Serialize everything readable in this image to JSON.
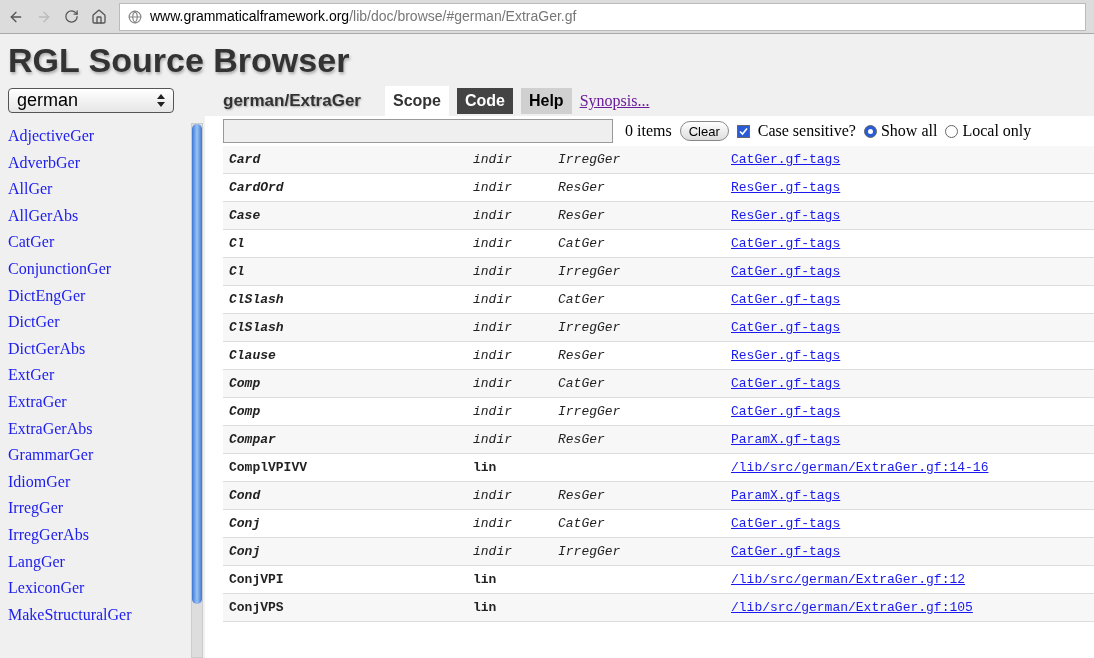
{
  "browser": {
    "url_host": "www.grammaticalframework.org",
    "url_path": "/lib/doc/browse/#german/ExtraGer.gf"
  },
  "title": "RGL Source Browser",
  "sidebar": {
    "language": "german",
    "scroll": {
      "level": 0.9
    },
    "items": [
      "AdjectiveGer",
      "AdverbGer",
      "AllGer",
      "AllGerAbs",
      "CatGer",
      "ConjunctionGer",
      "DictEngGer",
      "DictGer",
      "DictGerAbs",
      "ExtGer",
      "ExtraGer",
      "ExtraGerAbs",
      "GrammarGer",
      "IdiomGer",
      "IrregGer",
      "IrregGerAbs",
      "LangGer",
      "LexiconGer",
      "MakeStructuralGer"
    ]
  },
  "module": "german/ExtraGer",
  "tabs": [
    {
      "label": "Scope",
      "selected": true,
      "highlighted": false
    },
    {
      "label": "Code",
      "selected": false,
      "highlighted": true
    },
    {
      "label": "Help",
      "selected": false,
      "highlighted": false
    }
  ],
  "synopsis_link": "Synopsis...",
  "filter": {
    "count": "0 items",
    "clear": "Clear",
    "case_label": "Case sensitive?",
    "case_checked": true,
    "options": [
      {
        "label": "Show all",
        "selected": true
      },
      {
        "label": "Local only",
        "selected": false
      }
    ]
  },
  "rows": [
    {
      "kind": "indir",
      "name": "Card",
      "type": "indir",
      "module": "IrregGer",
      "link": "CatGer.gf-tags"
    },
    {
      "kind": "indir",
      "name": "CardOrd",
      "type": "indir",
      "module": "ResGer",
      "link": "ResGer.gf-tags"
    },
    {
      "kind": "indir",
      "name": "Case",
      "type": "indir",
      "module": "ResGer",
      "link": "ResGer.gf-tags"
    },
    {
      "kind": "indir",
      "name": "Cl",
      "type": "indir",
      "module": "CatGer",
      "link": "CatGer.gf-tags"
    },
    {
      "kind": "indir",
      "name": "Cl",
      "type": "indir",
      "module": "IrregGer",
      "link": "CatGer.gf-tags"
    },
    {
      "kind": "indir",
      "name": "ClSlash",
      "type": "indir",
      "module": "CatGer",
      "link": "CatGer.gf-tags"
    },
    {
      "kind": "indir",
      "name": "ClSlash",
      "type": "indir",
      "module": "IrregGer",
      "link": "CatGer.gf-tags"
    },
    {
      "kind": "indir",
      "name": "Clause",
      "type": "indir",
      "module": "ResGer",
      "link": "ResGer.gf-tags"
    },
    {
      "kind": "indir",
      "name": "Comp",
      "type": "indir",
      "module": "CatGer",
      "link": "CatGer.gf-tags"
    },
    {
      "kind": "indir",
      "name": "Comp",
      "type": "indir",
      "module": "IrregGer",
      "link": "CatGer.gf-tags"
    },
    {
      "kind": "indir",
      "name": "Compar",
      "type": "indir",
      "module": "ResGer",
      "link": "ParamX.gf-tags"
    },
    {
      "kind": "lin",
      "name": "ComplVPIVV",
      "type": "lin",
      "link": "/lib/src/german/ExtraGer.gf:14-16"
    },
    {
      "kind": "indir",
      "name": "Cond",
      "type": "indir",
      "module": "ResGer",
      "link": "ParamX.gf-tags"
    },
    {
      "kind": "indir",
      "name": "Conj",
      "type": "indir",
      "module": "CatGer",
      "link": "CatGer.gf-tags"
    },
    {
      "kind": "indir",
      "name": "Conj",
      "type": "indir",
      "module": "IrregGer",
      "link": "CatGer.gf-tags"
    },
    {
      "kind": "lin",
      "name": "ConjVPI",
      "type": "lin",
      "link": "/lib/src/german/ExtraGer.gf:12"
    },
    {
      "kind": "lin",
      "name": "ConjVPS",
      "type": "lin",
      "link": "/lib/src/german/ExtraGer.gf:105"
    }
  ]
}
